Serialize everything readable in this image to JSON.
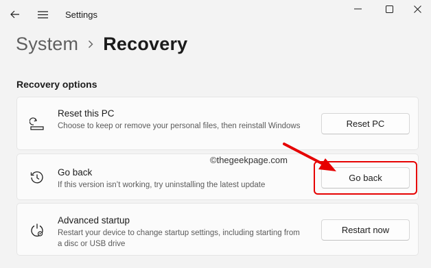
{
  "window": {
    "title": "Settings",
    "back_icon": "back-arrow-icon",
    "menu_icon": "hamburger-menu-icon",
    "controls": [
      "minimize-icon",
      "maximize-icon",
      "close-icon"
    ]
  },
  "breadcrumb": {
    "parent": "System",
    "separator_icon": "chevron-right-icon",
    "current": "Recovery"
  },
  "section": {
    "title": "Recovery options"
  },
  "options": [
    {
      "icon": "reset-pc-icon",
      "title": "Reset this PC",
      "description": "Choose to keep or remove your personal files, then reinstall Windows",
      "button": "Reset PC"
    },
    {
      "icon": "go-back-history-icon",
      "title": "Go back",
      "description": "If this version isn’t working, try uninstalling the latest update",
      "button": "Go back"
    },
    {
      "icon": "advanced-startup-icon",
      "title": "Advanced startup",
      "description": "Restart your device to change startup settings, including starting from a disc or USB drive",
      "button": "Restart now"
    }
  ],
  "annotation": {
    "watermark": "©thegeekpage.com",
    "highlight_color": "#e60000"
  }
}
